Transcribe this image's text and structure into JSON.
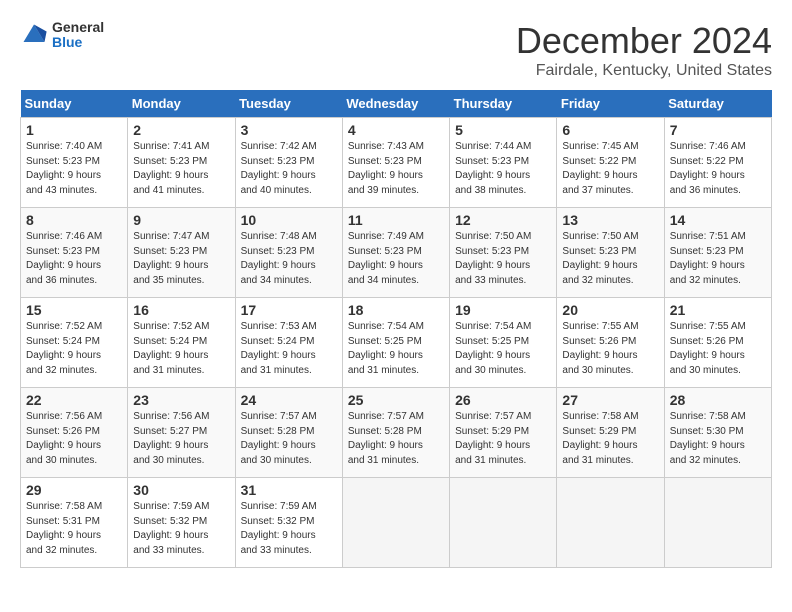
{
  "logo": {
    "general": "General",
    "blue": "Blue"
  },
  "header": {
    "title": "December 2024",
    "subtitle": "Fairdale, Kentucky, United States"
  },
  "weekdays": [
    "Sunday",
    "Monday",
    "Tuesday",
    "Wednesday",
    "Thursday",
    "Friday",
    "Saturday"
  ],
  "weeks": [
    [
      {
        "day": "1",
        "sunrise": "7:40 AM",
        "sunset": "5:23 PM",
        "daylight": "9 hours and 43 minutes."
      },
      {
        "day": "2",
        "sunrise": "7:41 AM",
        "sunset": "5:23 PM",
        "daylight": "9 hours and 41 minutes."
      },
      {
        "day": "3",
        "sunrise": "7:42 AM",
        "sunset": "5:23 PM",
        "daylight": "9 hours and 40 minutes."
      },
      {
        "day": "4",
        "sunrise": "7:43 AM",
        "sunset": "5:23 PM",
        "daylight": "9 hours and 39 minutes."
      },
      {
        "day": "5",
        "sunrise": "7:44 AM",
        "sunset": "5:23 PM",
        "daylight": "9 hours and 38 minutes."
      },
      {
        "day": "6",
        "sunrise": "7:45 AM",
        "sunset": "5:22 PM",
        "daylight": "9 hours and 37 minutes."
      },
      {
        "day": "7",
        "sunrise": "7:46 AM",
        "sunset": "5:22 PM",
        "daylight": "9 hours and 36 minutes."
      }
    ],
    [
      {
        "day": "8",
        "sunrise": "7:46 AM",
        "sunset": "5:23 PM",
        "daylight": "9 hours and 36 minutes."
      },
      {
        "day": "9",
        "sunrise": "7:47 AM",
        "sunset": "5:23 PM",
        "daylight": "9 hours and 35 minutes."
      },
      {
        "day": "10",
        "sunrise": "7:48 AM",
        "sunset": "5:23 PM",
        "daylight": "9 hours and 34 minutes."
      },
      {
        "day": "11",
        "sunrise": "7:49 AM",
        "sunset": "5:23 PM",
        "daylight": "9 hours and 34 minutes."
      },
      {
        "day": "12",
        "sunrise": "7:50 AM",
        "sunset": "5:23 PM",
        "daylight": "9 hours and 33 minutes."
      },
      {
        "day": "13",
        "sunrise": "7:50 AM",
        "sunset": "5:23 PM",
        "daylight": "9 hours and 32 minutes."
      },
      {
        "day": "14",
        "sunrise": "7:51 AM",
        "sunset": "5:23 PM",
        "daylight": "9 hours and 32 minutes."
      }
    ],
    [
      {
        "day": "15",
        "sunrise": "7:52 AM",
        "sunset": "5:24 PM",
        "daylight": "9 hours and 32 minutes."
      },
      {
        "day": "16",
        "sunrise": "7:52 AM",
        "sunset": "5:24 PM",
        "daylight": "9 hours and 31 minutes."
      },
      {
        "day": "17",
        "sunrise": "7:53 AM",
        "sunset": "5:24 PM",
        "daylight": "9 hours and 31 minutes."
      },
      {
        "day": "18",
        "sunrise": "7:54 AM",
        "sunset": "5:25 PM",
        "daylight": "9 hours and 31 minutes."
      },
      {
        "day": "19",
        "sunrise": "7:54 AM",
        "sunset": "5:25 PM",
        "daylight": "9 hours and 30 minutes."
      },
      {
        "day": "20",
        "sunrise": "7:55 AM",
        "sunset": "5:26 PM",
        "daylight": "9 hours and 30 minutes."
      },
      {
        "day": "21",
        "sunrise": "7:55 AM",
        "sunset": "5:26 PM",
        "daylight": "9 hours and 30 minutes."
      }
    ],
    [
      {
        "day": "22",
        "sunrise": "7:56 AM",
        "sunset": "5:26 PM",
        "daylight": "9 hours and 30 minutes."
      },
      {
        "day": "23",
        "sunrise": "7:56 AM",
        "sunset": "5:27 PM",
        "daylight": "9 hours and 30 minutes."
      },
      {
        "day": "24",
        "sunrise": "7:57 AM",
        "sunset": "5:28 PM",
        "daylight": "9 hours and 30 minutes."
      },
      {
        "day": "25",
        "sunrise": "7:57 AM",
        "sunset": "5:28 PM",
        "daylight": "9 hours and 31 minutes."
      },
      {
        "day": "26",
        "sunrise": "7:57 AM",
        "sunset": "5:29 PM",
        "daylight": "9 hours and 31 minutes."
      },
      {
        "day": "27",
        "sunrise": "7:58 AM",
        "sunset": "5:29 PM",
        "daylight": "9 hours and 31 minutes."
      },
      {
        "day": "28",
        "sunrise": "7:58 AM",
        "sunset": "5:30 PM",
        "daylight": "9 hours and 32 minutes."
      }
    ],
    [
      {
        "day": "29",
        "sunrise": "7:58 AM",
        "sunset": "5:31 PM",
        "daylight": "9 hours and 32 minutes."
      },
      {
        "day": "30",
        "sunrise": "7:59 AM",
        "sunset": "5:32 PM",
        "daylight": "9 hours and 33 minutes."
      },
      {
        "day": "31",
        "sunrise": "7:59 AM",
        "sunset": "5:32 PM",
        "daylight": "9 hours and 33 minutes."
      },
      null,
      null,
      null,
      null
    ]
  ]
}
